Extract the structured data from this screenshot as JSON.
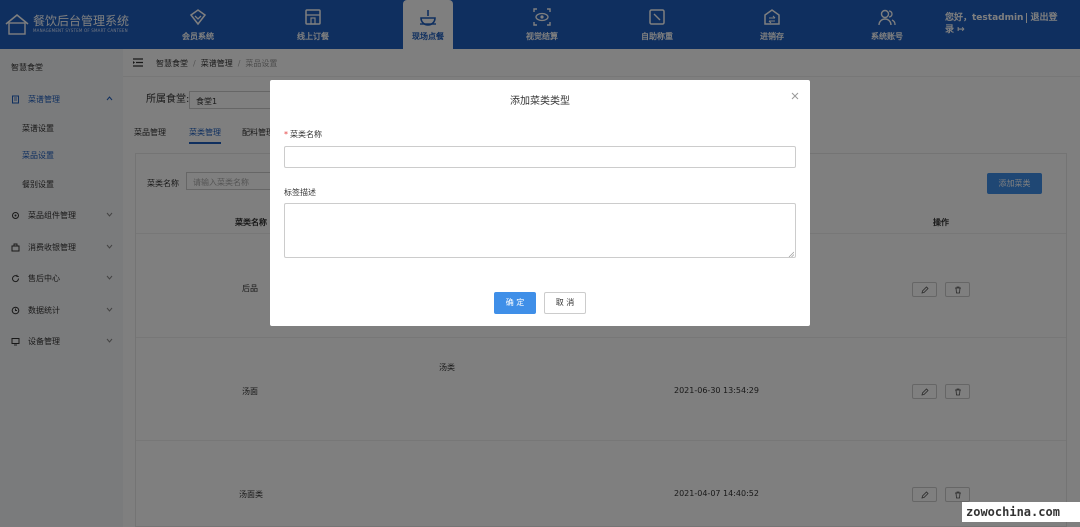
{
  "header": {
    "app_title": "餐饮后台管理系统",
    "app_subtitle": "MANAGEMENT SYSTEM OF SMART CANTEEN",
    "nav": [
      {
        "label": "会员系统",
        "icon": "diamond-icon"
      },
      {
        "label": "线上订餐",
        "icon": "storefront-icon"
      },
      {
        "label": "现场点餐",
        "icon": "dish-icon",
        "active": true
      },
      {
        "label": "视觉结算",
        "icon": "eye-scan-icon"
      },
      {
        "label": "自助称重",
        "icon": "scale-icon"
      },
      {
        "label": "进销存",
        "icon": "exchange-icon"
      },
      {
        "label": "系统账号",
        "icon": "users-icon"
      }
    ],
    "user_greeting": "您好，testadmin",
    "logout_label": "退出登录"
  },
  "sidebar": {
    "top_label": "智慧食堂",
    "items": [
      {
        "label": "菜谱管理",
        "icon": "menu-book-icon",
        "open": true,
        "children": [
          "菜谱设置",
          "菜品设置",
          "餐别设置"
        ],
        "active_child": 1
      },
      {
        "label": "菜品组件管理",
        "icon": "gear-icon"
      },
      {
        "label": "消费收银管理",
        "icon": "register-icon"
      },
      {
        "label": "售后中心",
        "icon": "refresh-icon"
      },
      {
        "label": "数据统计",
        "icon": "clock-icon"
      },
      {
        "label": "设备管理",
        "icon": "device-icon"
      }
    ]
  },
  "breadcrumb": [
    "智慧食堂",
    "菜谱管理",
    "菜品设置"
  ],
  "filters": {
    "canteen_label": "所属食堂:",
    "canteen_value": "食堂1"
  },
  "tabs": [
    {
      "label": "菜品管理"
    },
    {
      "label": "菜类管理",
      "active": true
    },
    {
      "label": "配料管理"
    }
  ],
  "panel": {
    "search_label": "菜类名称",
    "search_placeholder": "请输入菜类名称",
    "add_button": "添加菜类",
    "columns": [
      "菜类名称",
      "操作"
    ],
    "rows": [
      {
        "name": "后品",
        "desc": "",
        "time": ""
      },
      {
        "name": "汤面",
        "desc": "汤类",
        "time": "2021-06-30 13:54:29"
      },
      {
        "name": "汤面类",
        "desc": "",
        "time": "2021-04-07 14:40:52"
      }
    ]
  },
  "dialog": {
    "title": "添加菜类类型",
    "name_label": "菜类名称",
    "name_value": "",
    "desc_label": "标签描述",
    "desc_value": "",
    "ok_label": "确 定",
    "cancel_label": "取 消"
  },
  "watermark": "zowochina.com",
  "colors": {
    "primary": "#1f5fbf",
    "button": "#3f8fe8",
    "required": "#e54545"
  }
}
